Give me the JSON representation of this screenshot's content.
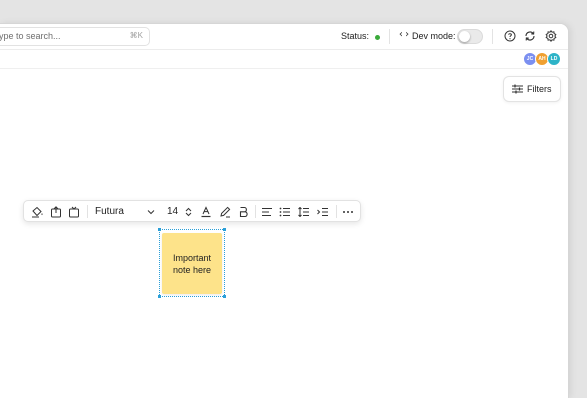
{
  "search": {
    "placeholder": "ype to search...",
    "shortcut": "⌘K"
  },
  "status": {
    "label": "Status:",
    "color": "#3aaa3a"
  },
  "dev_mode": {
    "label": "Dev mode:",
    "enabled": false
  },
  "toolbar_icons": [
    "code-icon",
    "help-icon",
    "sync-icon",
    "settings-icon"
  ],
  "avatars": [
    {
      "initials": "JC",
      "color": "#7b8ff0"
    },
    {
      "initials": "AH",
      "color": "#f0a030"
    },
    {
      "initials": "LD",
      "color": "#2db3c7"
    }
  ],
  "filters": {
    "label": "Filters"
  },
  "format_bar": {
    "font": "Futura",
    "size": "14",
    "tools": [
      "fill-icon",
      "bring-forward-icon",
      "send-backward-icon",
      "font-dropdown",
      "size-stepper",
      "text-color-icon",
      "highlight-icon",
      "bold-icon",
      "align-icon",
      "bullet-list-icon",
      "line-spacing-icon",
      "indent-icon",
      "more-icon"
    ]
  },
  "note": {
    "text": "Important note here",
    "color": "#fde38a"
  }
}
